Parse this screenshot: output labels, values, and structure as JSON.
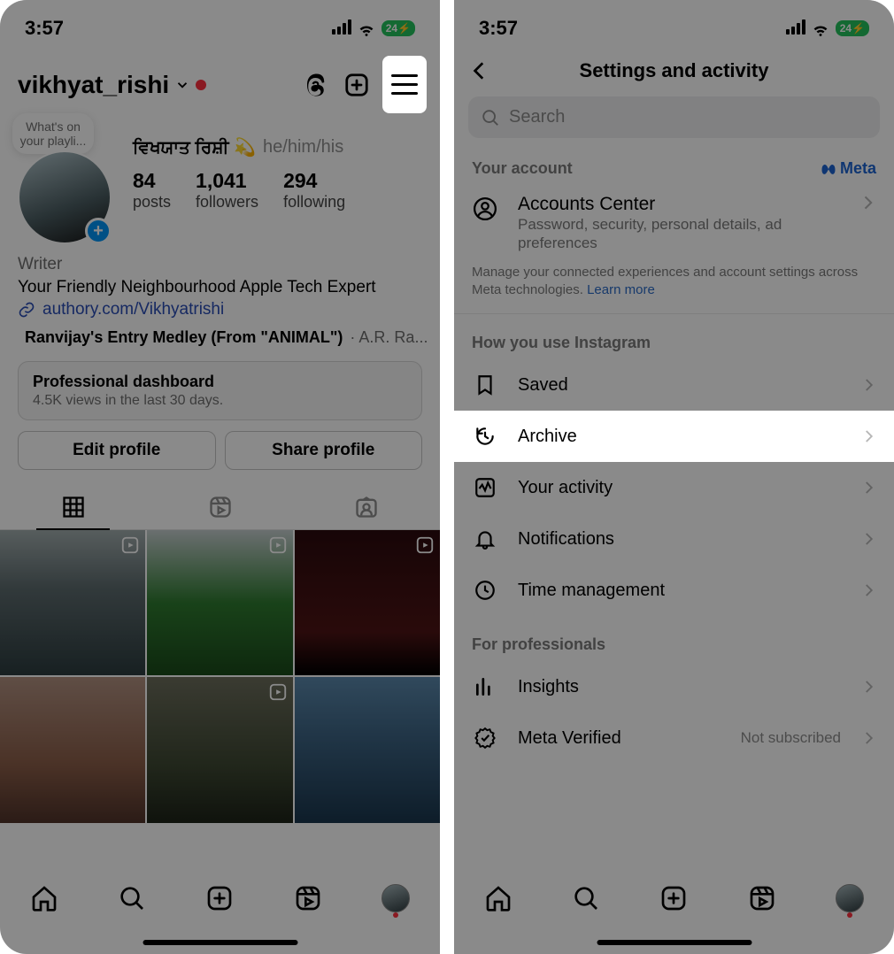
{
  "status": {
    "time": "3:57",
    "battery": "24"
  },
  "profile": {
    "username": "vikhyat_rishi",
    "note_text": "What's on your playli...",
    "display_name": "ਵਿਖਯਾਤ ਰਿਸ਼ੀ 💫",
    "pronouns": "he/him/his",
    "stats": {
      "posts": {
        "count": "84",
        "label": "posts"
      },
      "followers": {
        "count": "1,041",
        "label": "followers"
      },
      "following": {
        "count": "294",
        "label": "following"
      }
    },
    "category": "Writer",
    "bio_line": "Your Friendly Neighbourhood Apple Tech Expert",
    "link_text": "authory.com/Vikhyatrishi",
    "music": {
      "title": "Ranvijay's Entry Medley (From \"ANIMAL\")",
      "artist": "· A.R. Ra..."
    },
    "dashboard": {
      "title": "Professional dashboard",
      "subtitle": "4.5K views in the last 30 days."
    },
    "buttons": {
      "edit": "Edit profile",
      "share": "Share profile"
    }
  },
  "settings": {
    "header": "Settings and activity",
    "search_placeholder": "Search",
    "your_account_label": "Your account",
    "meta_label": "Meta",
    "accounts_center": {
      "title": "Accounts Center",
      "subtitle": "Password, security, personal details, ad preferences"
    },
    "manage_note": "Manage your connected experiences and account settings across Meta technologies. ",
    "learn_more": "Learn more",
    "sections": {
      "usage": {
        "title": "How you use Instagram",
        "saved": "Saved",
        "archive": "Archive",
        "activity": "Your activity",
        "notifications": "Notifications",
        "time": "Time management"
      },
      "pro": {
        "title": "For professionals",
        "insights": "Insights",
        "meta_verified": "Meta Verified",
        "meta_verified_trail": "Not subscribed"
      }
    }
  }
}
